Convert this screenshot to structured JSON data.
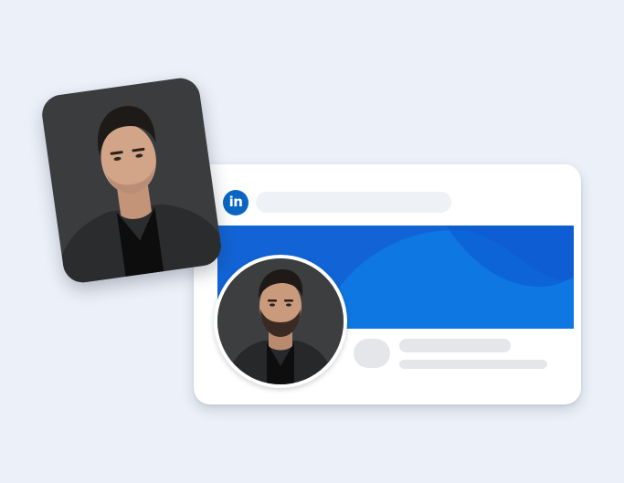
{
  "brand": {
    "logo_text": "in",
    "logo_icon": "linkedin-icon",
    "accent": "#0A66C2",
    "banner_color": "#1264D6"
  },
  "profile": {
    "avatar_icon": "profile-photo",
    "standalone_photo_icon": "portrait-photo"
  },
  "colors": {
    "background": "#ECF0F8",
    "card": "#FFFFFF",
    "placeholder": "#E4E6E9"
  }
}
